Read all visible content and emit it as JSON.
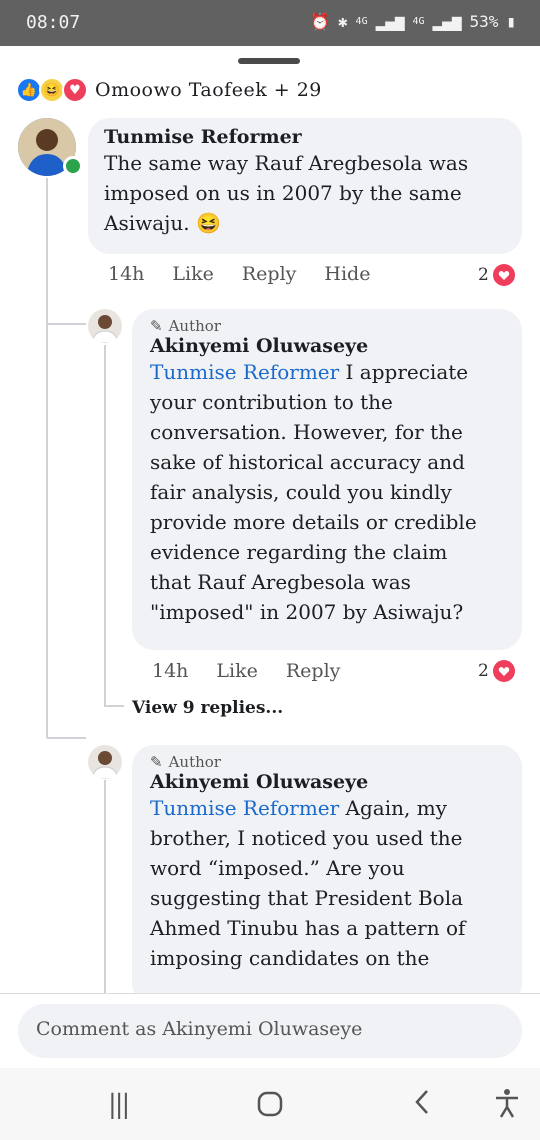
{
  "status": {
    "time": "08:07",
    "network1": "4G",
    "network2": "4G",
    "battery": "53%"
  },
  "reactions": {
    "reactors": "Omoowo Taofeek + 29"
  },
  "comments": [
    {
      "name": "Tunmise Reformer",
      "text_lines": [
        "The same way Rauf Aregbesola was",
        "imposed on us in 2007  by the same",
        "Asiwaju. 😆"
      ],
      "time": "14h",
      "like": "Like",
      "reply": "Reply",
      "hide": "Hide",
      "count": "2"
    },
    {
      "author_tag": "Author",
      "name": "Akinyemi Oluwaseye",
      "mention": "Tunmise Reformer",
      "first_line_rest": " I appreciate",
      "text_lines": [
        "your contribution to the",
        "conversation. However, for the",
        "sake of historical accuracy and",
        "fair analysis, could you kindly",
        "provide more details or credible",
        "evidence regarding the claim",
        "that Rauf Aregbesola was",
        "\"imposed\" in 2007 by Asiwaju?"
      ],
      "time": "14h",
      "like": "Like",
      "reply": "Reply",
      "count": "2",
      "view_replies": "View 9 replies..."
    },
    {
      "author_tag": "Author",
      "name": "Akinyemi Oluwaseye",
      "mention": "Tunmise Reformer",
      "first_line_rest": " Again, my",
      "text_lines": [
        "brother, I noticed you used the",
        "word “imposed.” Are you",
        "suggesting that President Bola",
        "Ahmed Tinubu has a pattern of",
        "imposing candidates on the"
      ]
    }
  ],
  "composer": {
    "placeholder": "Comment as Akinyemi Oluwaseye"
  },
  "navbar": {
    "recent": "|||",
    "home": "○",
    "back": "‹",
    "accessibility": "accessibility-icon"
  }
}
